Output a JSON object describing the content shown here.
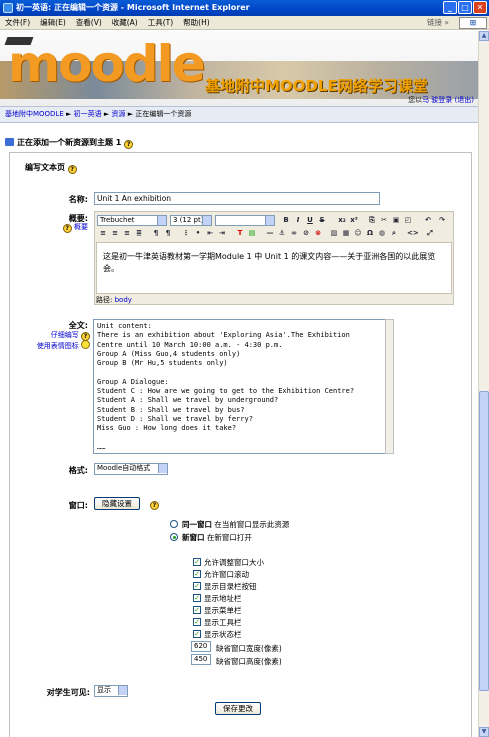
{
  "window": {
    "title": "初一英语: 正在编辑一个资源 - Microsoft Internet Explorer"
  },
  "menu": {
    "items": [
      "文件(F)",
      "编辑(E)",
      "查看(V)",
      "收藏(A)",
      "工具(T)",
      "帮助(H)"
    ],
    "links": "链接"
  },
  "header": {
    "logo": "moodle",
    "site_name": "基地附中MOODLE网络学习课堂",
    "login_text": "您以",
    "login_user": "马 骏登录",
    "logout": "(退出)"
  },
  "breadcrumb": {
    "items": [
      "基地附中MOODLE",
      "初一英语",
      "资源"
    ],
    "current": "正在编辑一个资源",
    "sep": "►"
  },
  "heading": {
    "text": "正在添加一个新资源到主题",
    "number": "1"
  },
  "form": {
    "legend": "编写文本页",
    "name_label": "名称:",
    "name_value": "Unit 1  An exhibition",
    "summary_label": "概要:",
    "summary_help_link": "概要",
    "editor": {
      "font": "Trebuchet",
      "size": "3 (12 pt)",
      "style": "",
      "content": "这是初一牛津英语教材第一学期Module 1 中 Unit 1 的课文内容——关于亚洲各国的以此展览会。",
      "path_label": "路径:",
      "path_value": "body"
    },
    "fulltext_label": "全文:",
    "fulltext_links": [
      "仔细编写",
      "使用表情图标"
    ],
    "fulltext": "Unit content:\nThere is an exhibition about 'Exploring Asia'.The Exhibition\nCentre until 10 March 10:00 a.m. - 4:30 p.m.\nGroup A (Miss Guo,4 students only)\nGroup B (Mr Hu,5 students only)\n\nGroup A Dialogue:\nStudent C : How are we going to get to the Exhibition Centre?\nStudent A : Shall we travel by underground?\nStudent B : Shall we travel by bus?\nStudent D : Shall we travel by ferry?\nMiss Guo : How long does it take?\n\n……",
    "format_label": "格式:",
    "format_value": "Moodle自动格式",
    "window_label": "窗口:",
    "hide_settings_button": "隐藏设置",
    "radio_same": {
      "label": "同一窗口",
      "desc": "在当前窗口显示此资源"
    },
    "radio_new": {
      "label": "新窗口",
      "desc": "在新窗口打开"
    },
    "checkboxes": [
      "允许调整窗口大小",
      "允许窗口滚动",
      "显示目录栏按钮",
      "显示地址栏",
      "显示菜单栏",
      "显示工具栏",
      "显示状态栏"
    ],
    "width_value": "620",
    "width_label": "缺省窗口宽度(像素)",
    "height_value": "450",
    "height_label": "缺省窗口高度(像素)",
    "visible_label": "对学生可见:",
    "visible_value": "显示",
    "save_button": "保存更改"
  }
}
